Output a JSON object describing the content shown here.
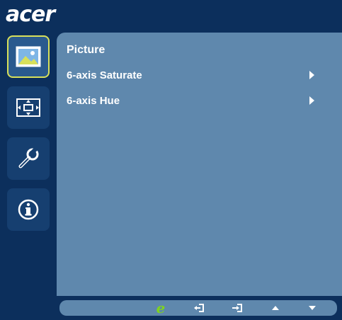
{
  "brand": {
    "logo_text": "acer"
  },
  "sidebar": {
    "tabs": [
      {
        "name": "picture",
        "icon": "picture-icon",
        "active": true
      },
      {
        "name": "position",
        "icon": "position-icon",
        "active": false
      },
      {
        "name": "settings",
        "icon": "wrench-icon",
        "active": false
      },
      {
        "name": "information",
        "icon": "info-icon",
        "active": false
      }
    ]
  },
  "panel": {
    "title": "Picture",
    "items": [
      {
        "label": "6-axis Saturate"
      },
      {
        "label": "6-axis Hue"
      }
    ]
  },
  "bottom_bar": {
    "buttons": [
      {
        "icon": "empowering-icon",
        "glyph": "e"
      },
      {
        "icon": "exit-icon",
        "glyph": "⇤"
      },
      {
        "icon": "enter-icon",
        "glyph": "⇥"
      },
      {
        "icon": "up-icon",
        "glyph": "▲"
      },
      {
        "icon": "down-icon",
        "glyph": "▼"
      }
    ]
  },
  "colors": {
    "background": "#0c2f5c",
    "panel": "#5f88ad",
    "active_border": "#d8e05a",
    "e_logo": "#7ed321"
  }
}
